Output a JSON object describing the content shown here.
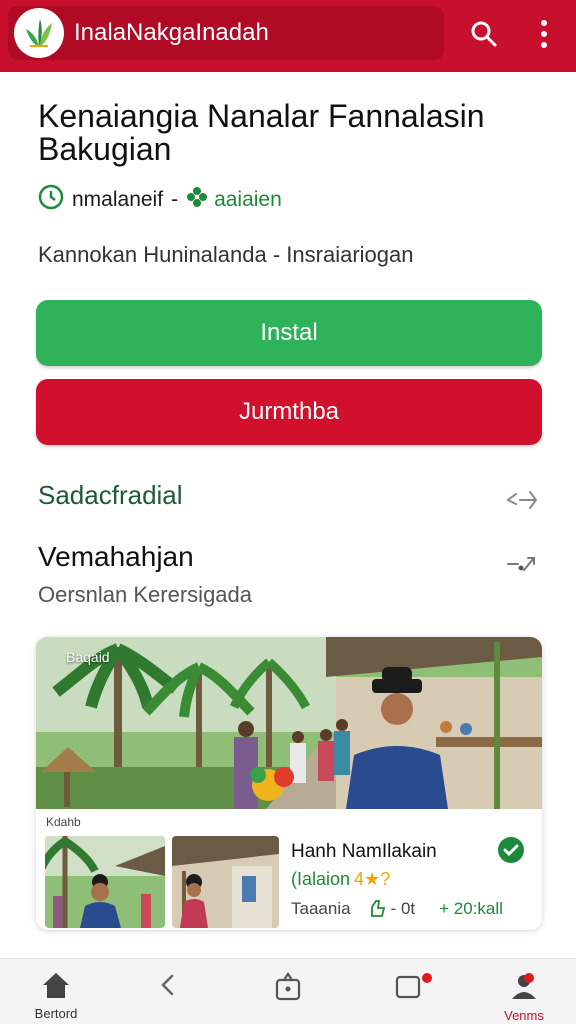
{
  "app_bar": {
    "title": "InalaNakgaInadah",
    "logo_icon": "leaf-logo-icon",
    "search_icon": "search-icon",
    "menu_icon": "more-vert-icon",
    "color": "#c8102e"
  },
  "header": {
    "title": "Kenaiangia Nanalar Fannalasin Bakugian",
    "meta_left": "nmalaneif",
    "meta_sep": "-",
    "meta_right": "aaiaien",
    "subtitle": "Kannokan Huninalanda - Insraiariogan"
  },
  "buttons": {
    "install": "Instal",
    "install_color": "#2fb35a",
    "secondary": "Jurmthba",
    "secondary_color": "#d0102c"
  },
  "sections": {
    "first_title": "Sadacfradial",
    "second_title": "Vemahahjan",
    "second_subtitle": "Oersnlan Kerersigada"
  },
  "card": {
    "hero_label": "Baqaid",
    "caption": "Kdahb",
    "name": "Hanh NamIlakain",
    "tag": "(Ialaion",
    "rating_marks": "4★?",
    "stat_left": "Taaania",
    "stat_mid": "- 0t",
    "stat_right": "+ 20:kall",
    "verified_icon": "check-badge-icon"
  },
  "bottom_nav": {
    "items": [
      {
        "label": "Bertord",
        "icon": "home-icon"
      },
      {
        "label": "",
        "icon": "back-chevron-icon"
      },
      {
        "label": "",
        "icon": "bag-icon"
      },
      {
        "label": "",
        "icon": "square-notification-icon"
      },
      {
        "label": "Venms",
        "icon": "profile-icon"
      }
    ]
  }
}
